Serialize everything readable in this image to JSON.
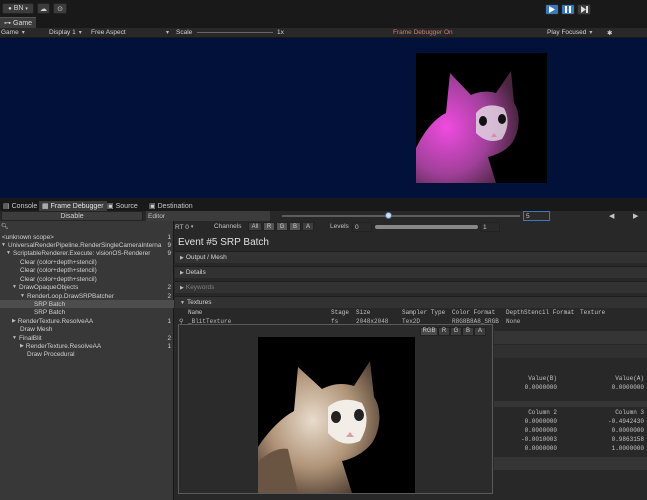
{
  "toolbar": {
    "account": "BN",
    "cloud_icon": "cloud-icon",
    "settings_icon": "settings-icon"
  },
  "game_tab": {
    "label": "Game"
  },
  "game_toolbar": {
    "view": "Game",
    "display": "Display 1",
    "aspect": "Free Aspect",
    "scale_label": "Scale",
    "scale_value": "1x",
    "frame_debugger_status": "Frame Debugger On",
    "play_mode": "Play Focused"
  },
  "bottom_tabs": {
    "console": "Console",
    "frame_debugger": "Frame Debugger",
    "source": "Source",
    "destination": "Destination"
  },
  "fd_toolbar": {
    "disable": "Disable",
    "target": "Editor",
    "event_number": "5"
  },
  "rt_bar": {
    "rt": "RT 0",
    "channels": "Channels",
    "all": "All",
    "r": "R",
    "g": "G",
    "b": "B",
    "a": "A",
    "levels": "Levels",
    "levels_min": "0",
    "levels_max": "1"
  },
  "tree": {
    "search_placeholder": "",
    "items": [
      {
        "label": "<unknown scope>",
        "count": "1"
      },
      {
        "label": "UniversalRenderPipeline.RenderSingleCameraInterna",
        "count": "9"
      },
      {
        "label": "ScriptableRenderer.Execute: visionOS-Renderer",
        "count": "9"
      },
      {
        "label": "Clear (color+depth+stencil)",
        "count": ""
      },
      {
        "label": "Clear (color+depth+stencil)",
        "count": ""
      },
      {
        "label": "Clear (color+depth+stencil)",
        "count": ""
      },
      {
        "label": "DrawOpaqueObjects",
        "count": "2"
      },
      {
        "label": "RenderLoop.DrawSRPBatcher",
        "count": "2"
      },
      {
        "label": "SRP Batch",
        "count": ""
      },
      {
        "label": "SRP Batch",
        "count": ""
      },
      {
        "label": "RenderTexture.ResolveAA",
        "count": "1"
      },
      {
        "label": "Draw Mesh",
        "count": ""
      },
      {
        "label": "FinalBlit",
        "count": "2"
      },
      {
        "label": "RenderTexture.ResolveAA",
        "count": "1"
      },
      {
        "label": "Draw Procedural",
        "count": ""
      }
    ]
  },
  "detail": {
    "title": "Event #5 SRP Batch",
    "sections": {
      "output": "Output / Mesh",
      "details": "Details",
      "keywords": "Keywords",
      "textures": "Textures"
    },
    "texture_headers": [
      "Name",
      "Stage",
      "Size",
      "Sampler Type",
      "Color Format",
      "DepthStencil Format",
      "Texture"
    ],
    "texture_row": [
      "_BlitTexture",
      "fs",
      "2048x2048",
      "Tex2D",
      "R8G8B8A8_SRGB",
      "None"
    ],
    "value_b_header": "Value(B)",
    "value_a_header": "Value(A)",
    "value_b": "0.0000000",
    "value_a": "0.0000000",
    "matrix_headers": [
      "Column 2",
      "Column 3"
    ],
    "matrix_rows": [
      [
        "0.0000000",
        "-0.4942430"
      ],
      [
        "0.0000000",
        "0.0000000"
      ],
      [
        "-0.0010003",
        "0.9863158"
      ],
      [
        "0.0000000",
        "1.0000000"
      ]
    ]
  },
  "popup": {
    "channels": [
      "RGB",
      "R",
      "G",
      "B",
      "A"
    ]
  },
  "colors": {
    "game_bg": "#01113a",
    "accent": "#3a79bb",
    "fd_status": "#d27a7a"
  }
}
